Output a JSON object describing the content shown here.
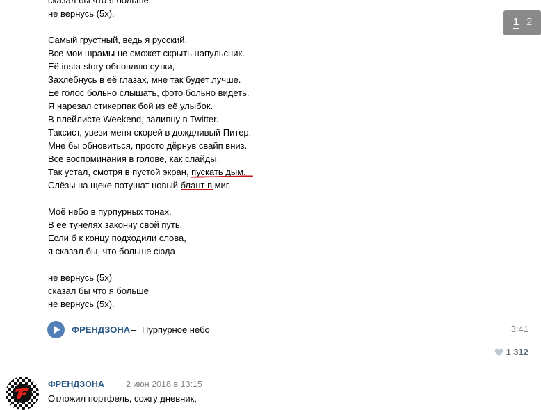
{
  "lyrics": [
    "сказал бы что я больше",
    "не вернусь (5x).",
    "",
    "Самый грустный, ведь я русский.",
    "Все мои шрамы не сможет скрыть напульсник.",
    "Её insta-story обновляю сутки,",
    "Захлебнусь в её глазах, мне так будет лучше.",
    "Её голос больно слышать, фото больно видеть.",
    "Я нарезал стикерпак бой из её улыбок.",
    "В плейлисте Weekend, залипну в Twitter.",
    "Таксист, увези меня скорей в дождливый Питер.",
    "Мне бы обновиться, просто дёрнув свайп вниз.",
    "Все воспоминания в голове, как слайды.",
    "Так устал, смотря в пустой экран, пускать дым.",
    "Слёзы на щеке потушат новый блант в миг.",
    "",
    "Моё небо в пурпурных тонах.",
    "В её тунелях закончу свой путь.",
    "Если б к концу подходили слова,",
    "я сказал бы, что больше сюда",
    "",
    "не вернусь (5x)",
    "сказал бы что я больше",
    "не вернусь (5x)."
  ],
  "pagination": {
    "current": "1",
    "next": "2"
  },
  "audio": {
    "artist": "ФРЕНДЗОНА",
    "separator": "–",
    "title": "Пурпурное небо",
    "duration": "3:41"
  },
  "likes": {
    "count": "1 312"
  },
  "next_post": {
    "author": "ФРЕНДЗОНА",
    "date": "2 июн 2018 в 13:15",
    "text": "Отложил портфель, сожгу дневник,"
  },
  "colors": {
    "link": "#2a5885",
    "play_button": "#5181b8",
    "annotation": "#c8141b"
  },
  "icons": [
    "play-icon",
    "heart-icon",
    "avatar-logo-icon"
  ]
}
